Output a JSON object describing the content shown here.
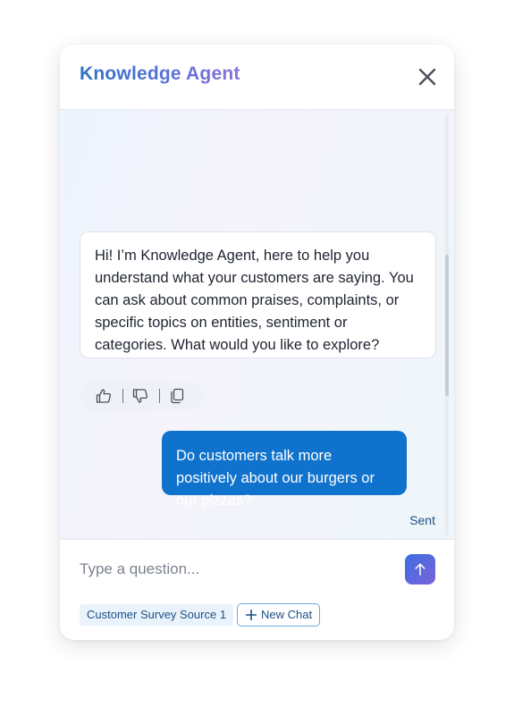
{
  "header": {
    "title": "Knowledge Agent",
    "close_icon": "close-icon"
  },
  "conversation": {
    "agent_message": "Hi! I’m Knowledge Agent, here to help you understand what your customers are saying. You can ask about common praises, complaints, or specific topics on entities, sentiment or categories. What would you like to explore?",
    "feedback_icons": [
      "thumbs-up-icon",
      "thumbs-down-icon",
      "copy-icon"
    ],
    "user_message": "Do customers talk more positively about our burgers or our pizzas?",
    "user_status": "Sent"
  },
  "composer": {
    "placeholder": "Type a question...",
    "value": "",
    "send_icon": "arrow-up-icon",
    "source_label": "Customer Survey Source 1",
    "new_chat_label": "New Chat"
  },
  "colors": {
    "accent": "#0f72cc",
    "title_gradient_start": "#2f6fc9",
    "title_gradient_end": "#8a6fe0",
    "send_gradient_start": "#3c6ee0",
    "send_gradient_end": "#7b63d9",
    "status_text": "#1c4f86"
  }
}
